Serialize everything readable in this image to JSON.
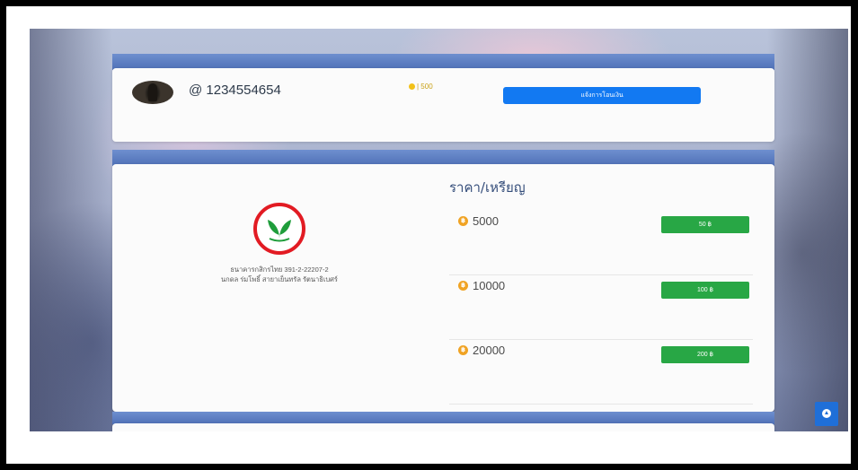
{
  "profile": {
    "username": "@ 1234554654",
    "coin_balance": "| 500",
    "report_button": "แจ้งการโอนเงิน"
  },
  "bank": {
    "line1": "ธนาคารกสิกรไทย 391-2-22207-2",
    "line2": "นกดล ร่มโพธิ์ สายาเย็นทรัล รัตนาธิเบศร์"
  },
  "price_section": {
    "title": "ราคา/เหรียญ",
    "coin_icon_glyph": "฿",
    "packages": [
      {
        "coins": "5000",
        "price": "50 ฿"
      },
      {
        "coins": "10000",
        "price": "100 ฿"
      },
      {
        "coins": "20000",
        "price": "200 ฿"
      }
    ]
  },
  "colors": {
    "accent_blue": "#1279f2",
    "buy_green": "#28a745",
    "coin_orange": "#f0a324",
    "logo_red": "#e21b23",
    "logo_green": "#1f9d3b"
  }
}
